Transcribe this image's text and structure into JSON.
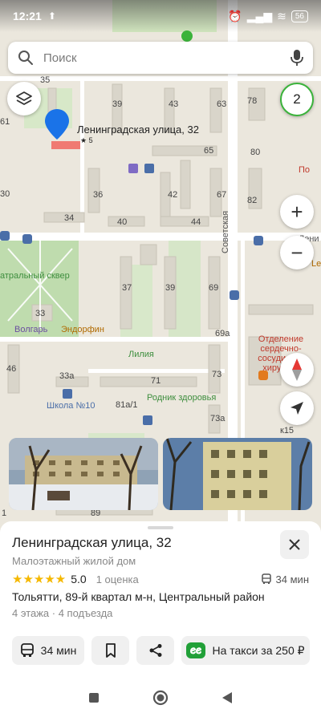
{
  "status_bar": {
    "time": "12:21",
    "battery": "56"
  },
  "search": {
    "placeholder": "Поиск"
  },
  "map": {
    "route_count": "2",
    "selected_label": "Ленинградская улица, 32",
    "selected_number": "5",
    "street_label": "Советская",
    "house_numbers": [
      "35",
      "39",
      "43",
      "63",
      "78",
      "61",
      "65",
      "80",
      "30",
      "36",
      "42",
      "67",
      "82",
      "34",
      "40",
      "44",
      "37",
      "39",
      "69",
      "69а",
      "46",
      "33а",
      "71",
      "73",
      "81а/1",
      "73а",
      "к15",
      "89",
      "33",
      "1"
    ],
    "pois": {
      "park": "атральный сквер",
      "volgar": "Волгарь",
      "endorfin": "Эндорфин",
      "liliya": "Лилия",
      "hospital": "Отделение сердечно-сосудистой хирургии",
      "rodnik": "Родник здоровья",
      "school": "Школа №10",
      "po": "По",
      "leni": "Лени",
      "le": "Le",
      "ya": "у"
    },
    "photos": [
      "courtyard-photo",
      "building-photo"
    ]
  },
  "place": {
    "title": "Ленинградская улица, 32",
    "type": "Малоэтажный жилой дом",
    "rating": "5.0",
    "rating_count": "1 оценка",
    "transit_time": "34 мин",
    "address": "Тольятти, 89-й квартал м-н, Центральный район",
    "details": "4 этажа · 4 подъезда"
  },
  "actions": {
    "transit_label": "34 мин",
    "taxi_label": "На такси за 250 ₽"
  },
  "colors": {
    "accent_blue": "#1a73e8",
    "route_green": "#3bb33b",
    "star_yellow": "#f5b800",
    "taxi_green": "#21a038"
  }
}
